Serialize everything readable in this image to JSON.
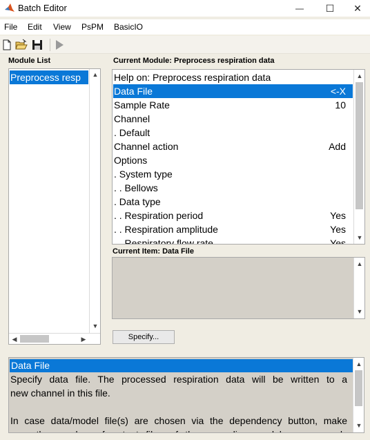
{
  "window": {
    "title": "Batch Editor",
    "min_glyph": "—",
    "max_glyph": "☐",
    "close_glyph": "✕"
  },
  "menu": [
    "File",
    "Edit",
    "View",
    "PsPM",
    "BasicIO"
  ],
  "toolbar": {
    "icons": [
      "new-file-icon",
      "open-folder-icon",
      "save-disk-icon",
      "run-play-icon"
    ]
  },
  "module_list": {
    "label": "Module List",
    "items": [
      "Preprocess resp"
    ]
  },
  "current_module": {
    "label": "Current Module: Preprocess respiration data",
    "rows": [
      {
        "text": "Help on: Preprocess respiration data",
        "value": ""
      },
      {
        "text": "Data File",
        "value": "<-X",
        "selected": true
      },
      {
        "text": "Sample Rate",
        "value": "10"
      },
      {
        "text": "Channel",
        "value": ""
      },
      {
        "text": ". Default",
        "value": ""
      },
      {
        "text": "Channel action",
        "value": "Add"
      },
      {
        "text": "Options",
        "value": ""
      },
      {
        "text": ". System type",
        "value": ""
      },
      {
        "text": ". . Bellows",
        "value": ""
      },
      {
        "text": ". Data type",
        "value": ""
      },
      {
        "text": ". . Respiration period",
        "value": "Yes"
      },
      {
        "text": ". . Respiration amplitude",
        "value": "Yes"
      },
      {
        "text": ". . Respiratory flow rate",
        "value": "Yes"
      }
    ]
  },
  "current_item": {
    "label": "Current Item: Data File"
  },
  "specify_button": "Specify...",
  "help": {
    "title": "Data File",
    "lines": [
      "Specify data file. The processed respiration data will be written to a",
      "new channel in this file.",
      "",
      "In case data/model file(s) are chosen via the dependency button, make",
      "sure the number of output files of the preceding module corresponds"
    ]
  },
  "colors": {
    "selection": "#0a78d7",
    "window_bg": "#f0ede3",
    "disabled_panel": "#d4d0c8"
  }
}
